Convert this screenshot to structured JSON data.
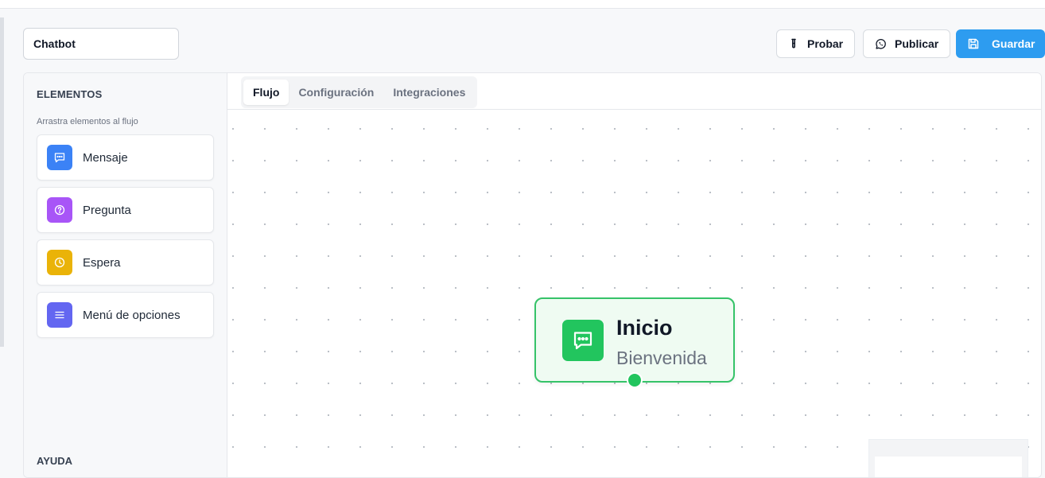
{
  "header": {
    "chatbot_name": "Chatbot",
    "buttons": {
      "test_label": "Probar",
      "publish_label": "Publicar",
      "save_label": "Guardar"
    }
  },
  "sidebar": {
    "title": "ELEMENTOS",
    "hint": "Arrastra elementos al flujo",
    "items": [
      {
        "label": "Mensaje",
        "icon": "message-icon",
        "color": "#3b82f6"
      },
      {
        "label": "Pregunta",
        "icon": "question-icon",
        "color": "#a855f7"
      },
      {
        "label": "Espera",
        "icon": "clock-icon",
        "color": "#eab308"
      },
      {
        "label": "Menú de opciones",
        "icon": "list-icon",
        "color": "#6366f1"
      }
    ],
    "help_title": "AYUDA"
  },
  "tabs": [
    {
      "label": "Flujo",
      "active": true
    },
    {
      "label": "Configuración",
      "active": false
    },
    {
      "label": "Integraciones",
      "active": false
    }
  ],
  "canvas": {
    "start_node": {
      "title": "Inicio",
      "subtitle": "Bienvenida",
      "icon": "chat-icon",
      "color": "#22c55e"
    }
  },
  "colors": {
    "primary": "#2d9cf0",
    "node_border": "#36c369",
    "node_bg": "#effbf2"
  }
}
